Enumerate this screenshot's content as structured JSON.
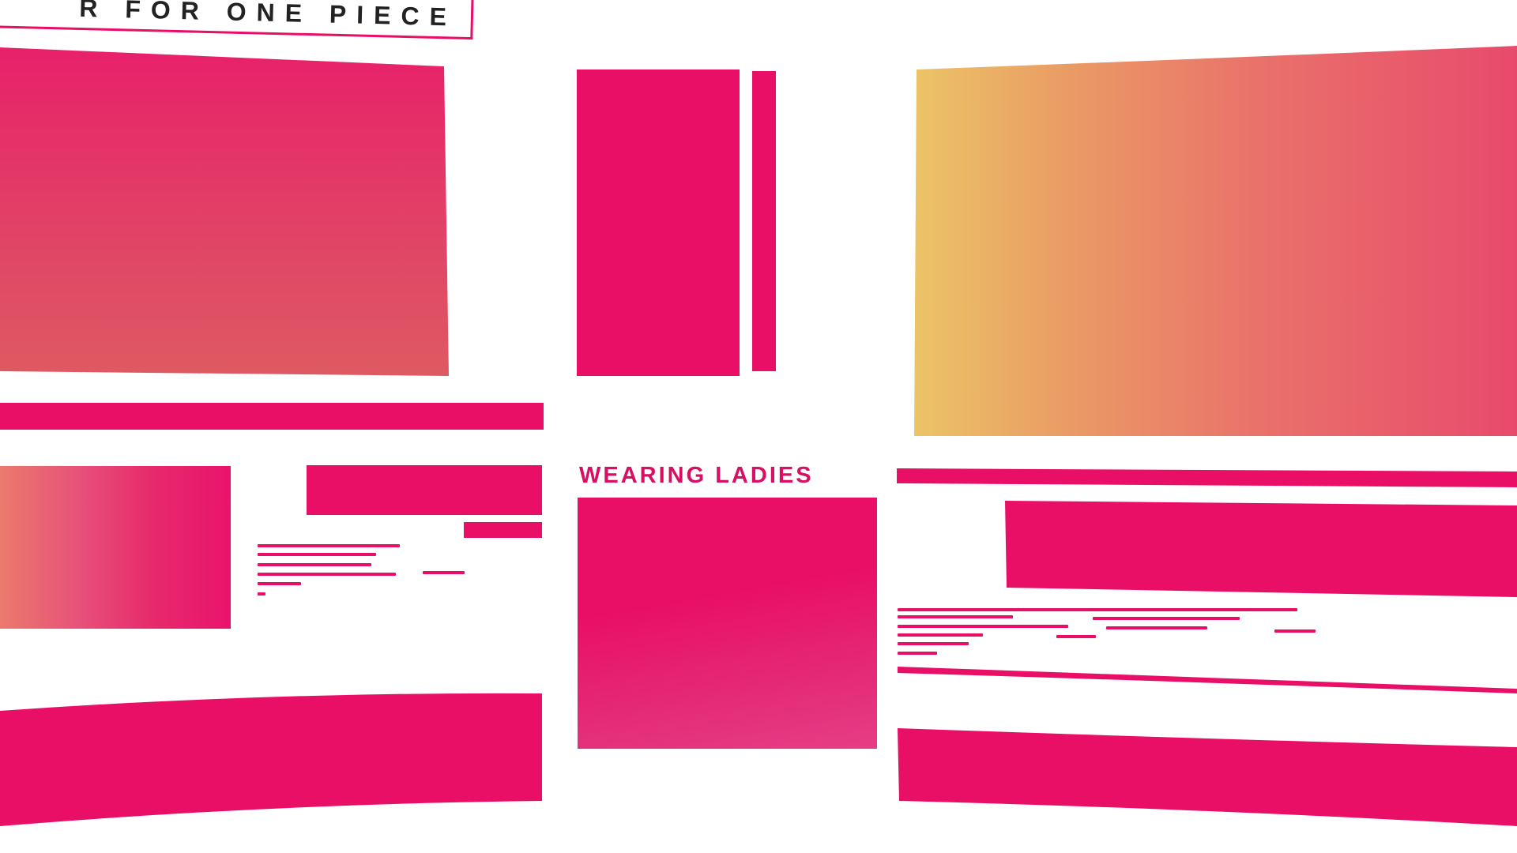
{
  "banner": {
    "text": "R FOR ONE PIECE"
  },
  "section": {
    "heading": "WEARING LADIES"
  },
  "colors": {
    "primary_pink": "#e90f67",
    "gradient_yellow": "#ebc466",
    "gradient_coral": "#e9746a",
    "text_dark": "#222222",
    "background": "#ffffff"
  }
}
